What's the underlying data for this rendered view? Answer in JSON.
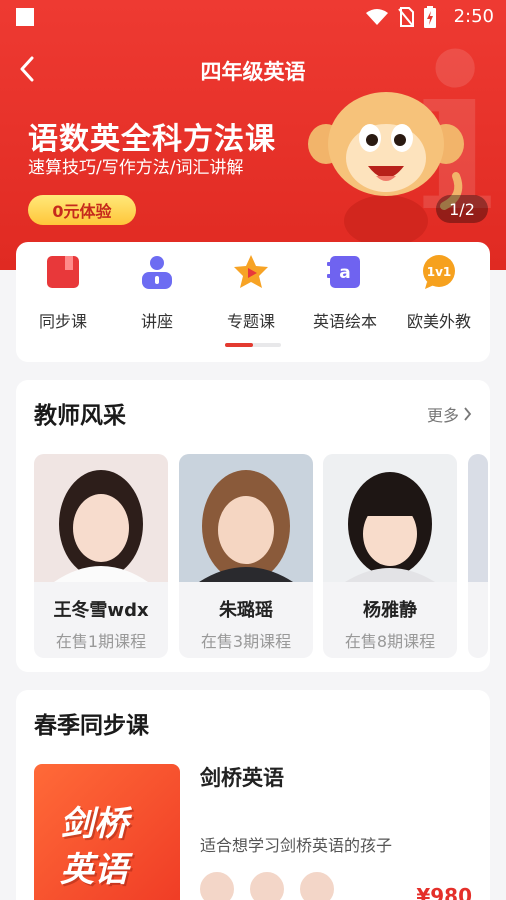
{
  "status_bar": {
    "time": "2:50"
  },
  "header": {
    "title": "四年级英语"
  },
  "banner": {
    "title": "语数英全科方法课",
    "subtitle": "速算技巧/写作方法/词汇讲解",
    "button": "0元体验",
    "pager": "1/2",
    "watermark": "i"
  },
  "categories": [
    {
      "label": "同步课",
      "icon": "book-icon",
      "color": "#e8383a"
    },
    {
      "label": "讲座",
      "icon": "lecturer-icon",
      "color": "#6d6cf2"
    },
    {
      "label": "专题课",
      "icon": "star-icon",
      "color": "#f7a325"
    },
    {
      "label": "英语绘本",
      "icon": "picture-book-icon",
      "color": "#6f63f0"
    },
    {
      "label": "欧美外教",
      "icon": "foreign-teacher-icon",
      "color": "#f6a11e",
      "badge": "1v1"
    }
  ],
  "teachers_section": {
    "title": "教师风采",
    "more": "更多",
    "teachers": [
      {
        "name": "王冬雪wdx",
        "info": "在售1期课程"
      },
      {
        "name": "朱璐瑶",
        "info": "在售3期课程"
      },
      {
        "name": "杨雅静",
        "info": "在售8期课程"
      }
    ]
  },
  "courses_section": {
    "title": "春季同步课",
    "course": {
      "cover_line1": "剑桥",
      "cover_line2": "英语",
      "name": "剑桥英语",
      "description": "适合想学习剑桥英语的孩子",
      "price": "¥980"
    }
  },
  "colors": {
    "brand_red": "#e8332b",
    "accent_yellow": "#ffd24a"
  }
}
